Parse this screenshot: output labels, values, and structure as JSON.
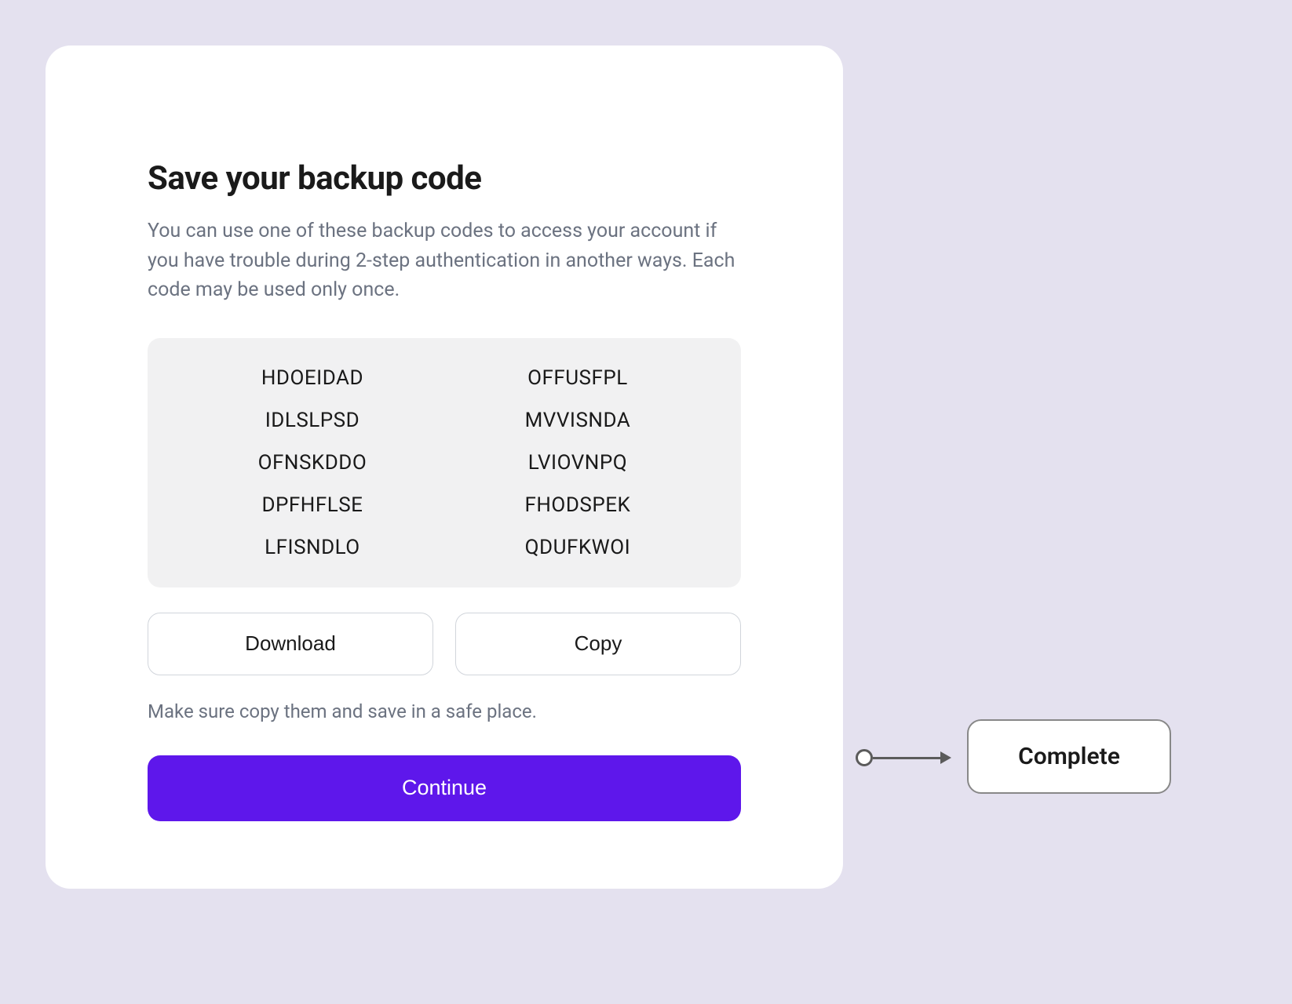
{
  "card": {
    "title": "Save your backup code",
    "description": "You can use one of these backup codes to access your account if you have trouble during 2-step authentication in another ways. Each code may be used only once.",
    "codes_left": [
      "HDOEIDAD",
      "IDLSLPSD",
      "OFNSKDDO",
      "DPFHFLSE",
      "LFISNDLO"
    ],
    "codes_right": [
      "OFFUSFPL",
      "MVVISNDA",
      "LVIOVNPQ",
      "FHODSPEK",
      "QDUFKWOI"
    ],
    "download_label": "Download",
    "copy_label": "Copy",
    "hint": "Make sure copy them and save in a safe place.",
    "continue_label": "Continue"
  },
  "flow": {
    "complete_label": "Complete"
  },
  "colors": {
    "background": "#e4e1ef",
    "card_bg": "#ffffff",
    "codes_bg": "#f1f1f2",
    "primary": "#5e17eb",
    "text_primary": "#1a1a1a",
    "text_secondary": "#6b7280",
    "border": "#d1d5db"
  }
}
